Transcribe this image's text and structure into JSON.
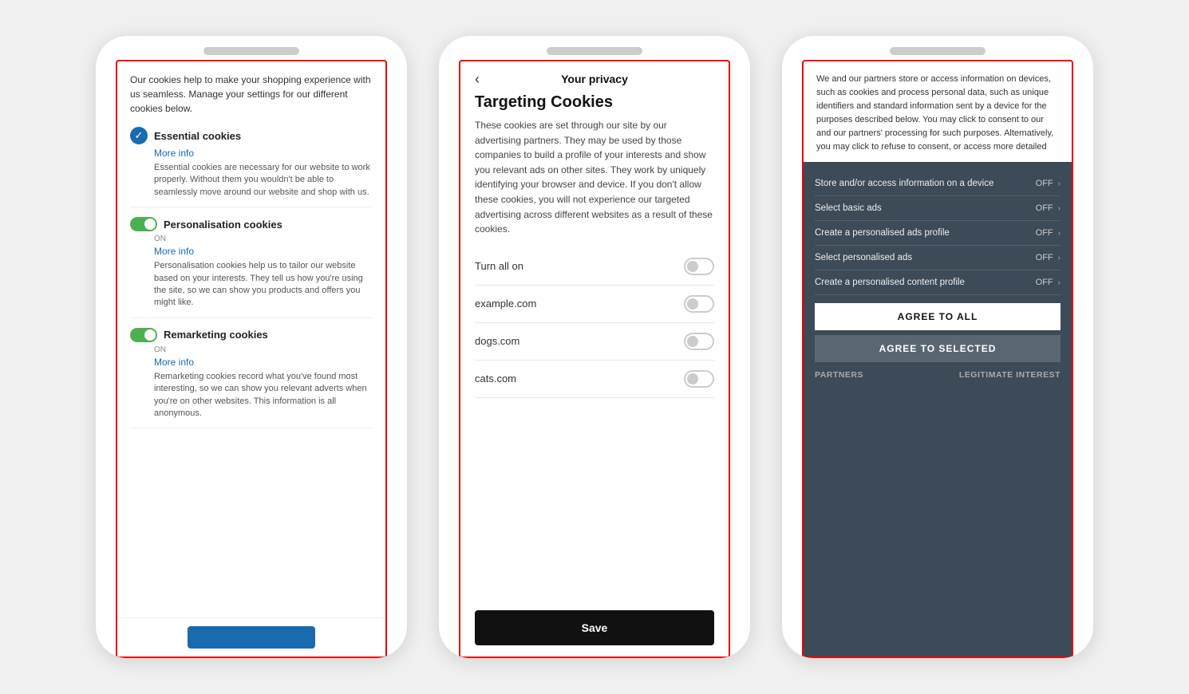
{
  "phone1": {
    "intro": "Our cookies help to make your shopping experience with us seamless. Manage your settings for our different cookies below.",
    "sections": [
      {
        "type": "check",
        "title": "Essential cookies",
        "more_info": "More info",
        "description": "Essential cookies are necessary for our website to work properly. Without them you wouldn't be able to seamlessly move around our website and shop with us."
      },
      {
        "type": "toggle",
        "on_label": "ON",
        "title": "Personalisation cookies",
        "more_info": "More info",
        "description": "Personalisation cookies help us to tailor our website based on your interests. They tell us how you're using the site, so we can show you products and offers you might like."
      },
      {
        "type": "toggle",
        "on_label": "ON",
        "title": "Remarketing cookies",
        "more_info": "More info",
        "description": "Remarketing cookies record what you've found most interesting, so we can show you relevant adverts when you're on other websites. This information is all anonymous."
      }
    ]
  },
  "phone2": {
    "back_label": "‹",
    "header_title": "Your privacy",
    "section_title": "Targeting Cookies",
    "description": "These cookies are set through our site by our advertising partners. They may be used by those companies to build a profile of your interests and show you relevant ads on other sites. They work by uniquely identifying your browser and device. If you don't allow these cookies, you will not experience our targeted advertising across different websites as a result of these cookies.",
    "rows": [
      {
        "label": "Turn all on",
        "toggle": true
      },
      {
        "label": "example.com",
        "toggle": true
      },
      {
        "label": "dogs.com",
        "toggle": true
      },
      {
        "label": "cats.com",
        "toggle": true
      }
    ],
    "save_label": "Save"
  },
  "phone3": {
    "body_text": "We and our partners store or access information on devices, such as cookies and process personal data, such as unique identifiers and standard information sent by a device for the purposes described below. You may click to consent to our and our partners' processing for such purposes. Alternatively, you may click to refuse to consent, or access more detailed",
    "items": [
      {
        "label": "Store and/or access information on a device",
        "status": "OFF"
      },
      {
        "label": "Select basic ads",
        "status": "OFF"
      },
      {
        "label": "Create a personalised ads profile",
        "status": "OFF"
      },
      {
        "label": "Select personalised ads",
        "status": "OFF"
      },
      {
        "label": "Create a personalised content profile",
        "status": "OFF"
      }
    ],
    "agree_all_label": "AGREE TO ALL",
    "agree_selected_label": "AGREE TO SELECTED",
    "footer_left": "PARTNERS",
    "footer_right": "LEGITIMATE INTEREST"
  }
}
